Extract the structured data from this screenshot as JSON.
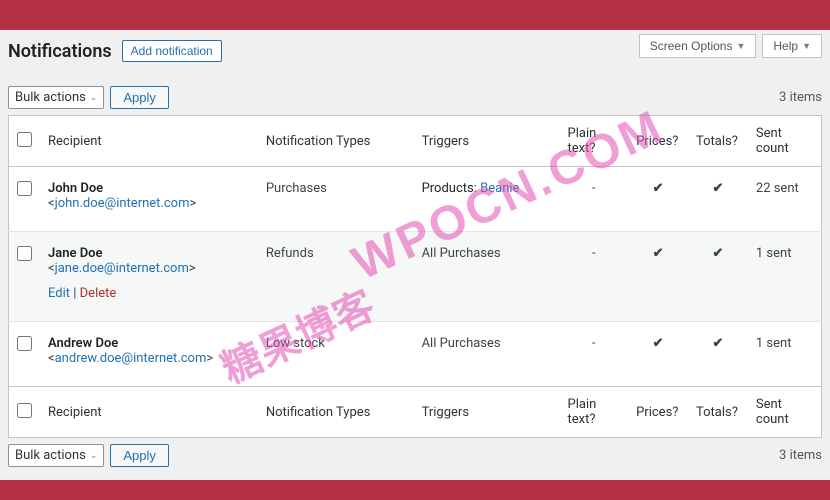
{
  "header": {
    "title": "Notifications",
    "add_button": "Add notification",
    "screen_options": "Screen Options",
    "help": "Help"
  },
  "tablenav": {
    "bulk_label": "Bulk actions",
    "apply_label": "Apply",
    "items_count": "3 items"
  },
  "columns": {
    "recipient": "Recipient",
    "types": "Notification Types",
    "triggers": "Triggers",
    "plain": "Plain text?",
    "prices": "Prices?",
    "totals": "Totals?",
    "sent": "Sent count"
  },
  "row_actions": {
    "edit": "Edit",
    "delete": "Delete"
  },
  "rows": [
    {
      "name": "John Doe",
      "email": "john.doe@internet.com",
      "types": "Purchases",
      "trigger_prefix": "Products:",
      "trigger_link": "Beanie",
      "trigger_text": "",
      "plain": "-",
      "prices": "✔",
      "totals": "✔",
      "sent": "22 sent",
      "show_actions": false
    },
    {
      "name": "Jane Doe",
      "email": "jane.doe@internet.com",
      "types": "Refunds",
      "trigger_prefix": "",
      "trigger_link": "",
      "trigger_text": "All Purchases",
      "plain": "-",
      "prices": "✔",
      "totals": "✔",
      "sent": "1 sent",
      "show_actions": true
    },
    {
      "name": "Andrew Doe",
      "email": "andrew.doe@internet.com",
      "types": "Low stock",
      "trigger_prefix": "",
      "trigger_link": "",
      "trigger_text": "All Purchases",
      "plain": "-",
      "prices": "✔",
      "totals": "✔",
      "sent": "1 sent",
      "show_actions": false
    }
  ],
  "watermark": {
    "line1": "WPOCN.COM",
    "line2": "糖果博客"
  }
}
